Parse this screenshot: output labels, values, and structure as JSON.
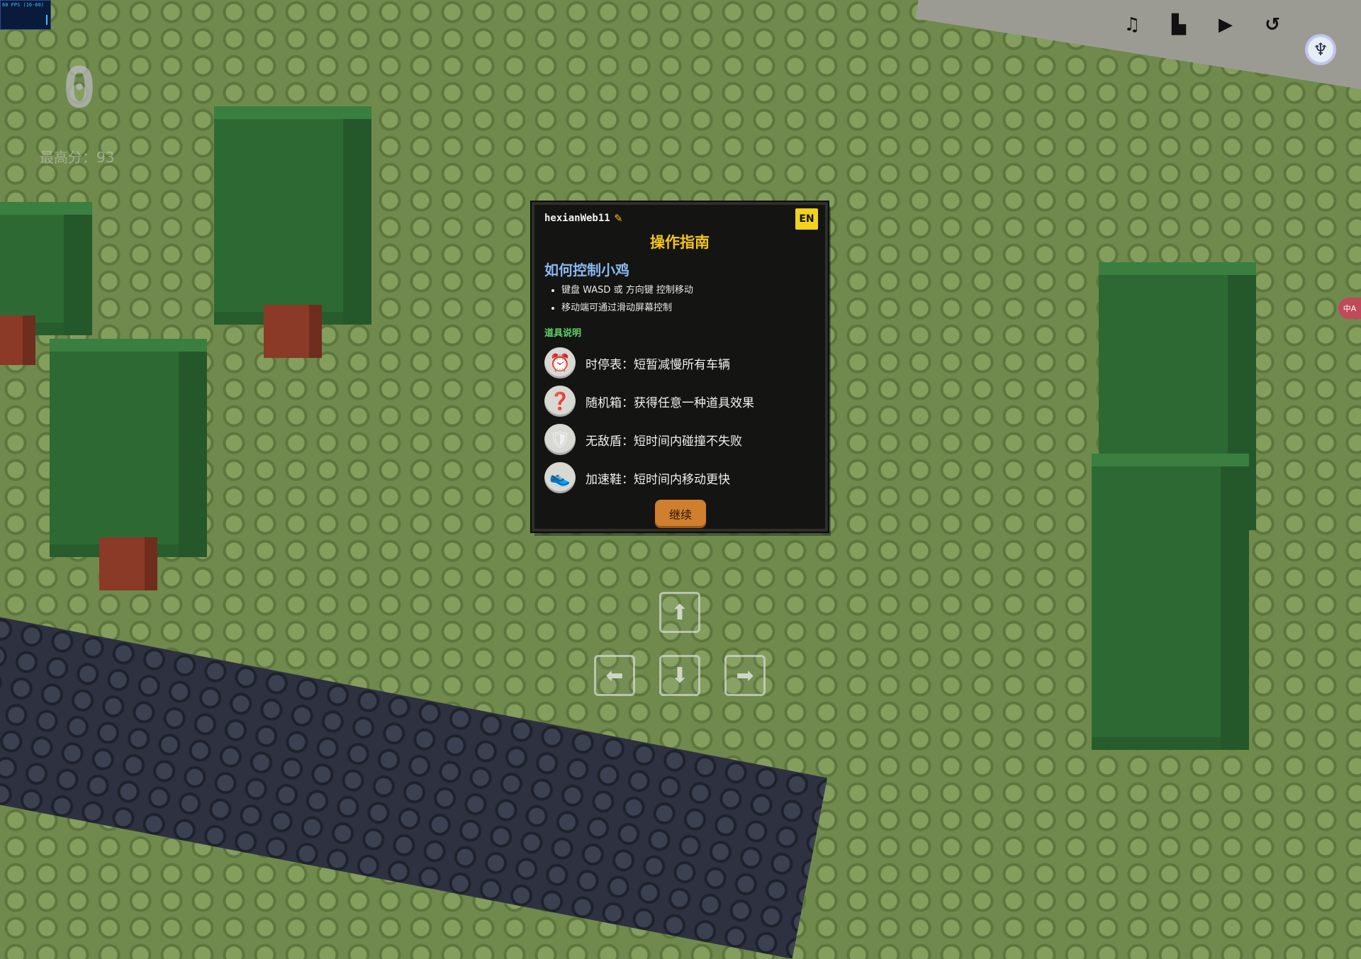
{
  "hud": {
    "fps_label": "60 FPS (16-60)",
    "score": "0",
    "best_score": "最高分：93"
  },
  "toolbar": {
    "music_icon": "♫",
    "leaderboard_icon": "▙",
    "play_icon": "▶",
    "restart_icon": "↺"
  },
  "avatar": {
    "icon": "♆"
  },
  "side_pill": {
    "label": "中A"
  },
  "dialog": {
    "username": "hexianWeb11",
    "lang_button": "EN",
    "title": "操作指南",
    "subtitle": "如何控制小鸡",
    "rules": [
      "键盘 WASD 或 方向键 控制移动",
      "移动端可通过滑动屏幕控制"
    ],
    "items_title": "道具说明",
    "items": [
      {
        "icon": "⏰",
        "text": "时停表：短暂减慢所有车辆"
      },
      {
        "icon": "❓",
        "text": "随机箱：获得任意一种道具效果"
      },
      {
        "icon": "🛡",
        "text": "无敌盾：短时间内碰撞不失败"
      },
      {
        "icon": "👟",
        "text": "加速鞋：短时间内移动更快"
      }
    ],
    "continue_button": "继续"
  },
  "arrows": {
    "up": "⬆",
    "left": "⬅",
    "down": "⬇",
    "right": "➡"
  }
}
